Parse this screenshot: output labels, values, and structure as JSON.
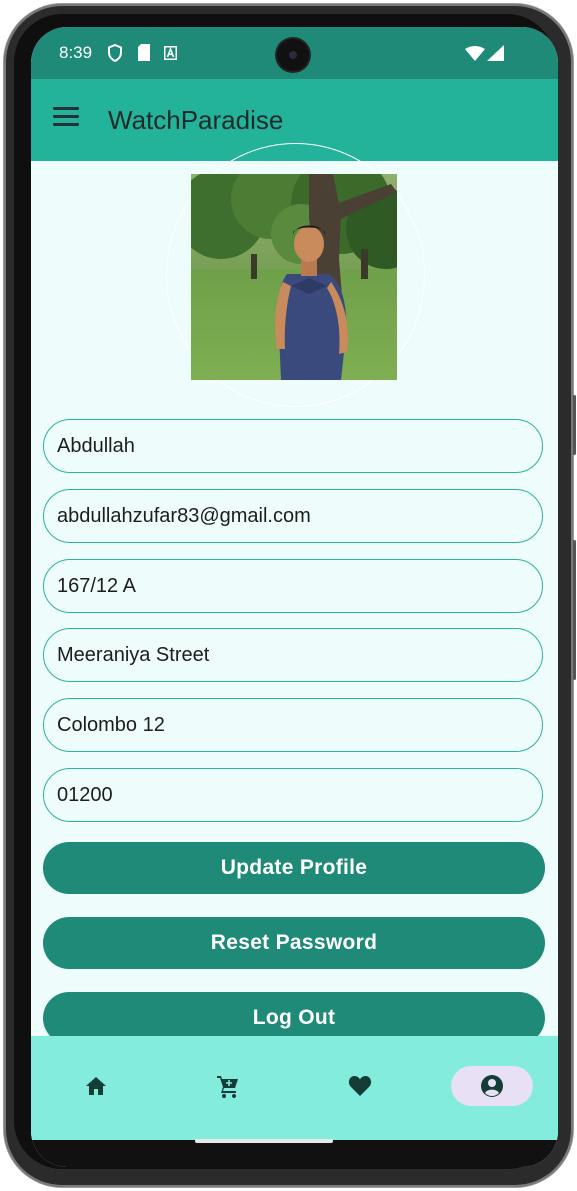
{
  "status_bar": {
    "time": "8:39",
    "icons": [
      "shield-icon",
      "sd-card-icon",
      "a-box-icon",
      "wifi-icon",
      "signal-icon"
    ]
  },
  "app_bar": {
    "title": "WatchParadise",
    "menu_icon": "menu-icon"
  },
  "profile": {
    "photo": "profile-photo"
  },
  "form": {
    "name": "Abdullah",
    "email": "abdullahzufar83@gmail.com",
    "address_line1": "167/12 A",
    "address_line2": "Meeraniya Street",
    "city": "Colombo 12",
    "postal_code": "01200"
  },
  "buttons": {
    "update_profile": "Update Profile",
    "reset_password": "Reset Password",
    "log_out": "Log Out"
  },
  "bottom_nav": {
    "items": [
      "home-icon",
      "cart-icon",
      "heart-icon",
      "account-icon"
    ],
    "active": "account-icon"
  },
  "colors": {
    "primary": "#1e8a77",
    "app_bar": "#23b29a",
    "background": "#eefcfb",
    "bottom_nav": "#84ecdd",
    "field_border": "#2bb39b",
    "active_pill": "#e8e0f4"
  }
}
